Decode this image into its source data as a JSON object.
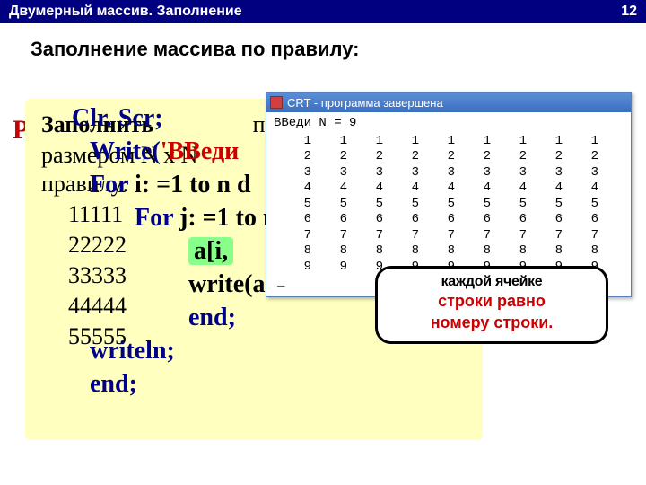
{
  "header": {
    "title": "Двумерный массив. Заполнение",
    "page": "12"
  },
  "subtitle": "Заполнение массива по правилу:",
  "red_letter": "Р",
  "task": {
    "line1a": "Заполнить",
    "line1b": "пр",
    "line2": "размером   N  x   N",
    "line3": "правилу:",
    "n1": "11111",
    "n2": "22222",
    "n3": "33333",
    "n4": "44444",
    "n5": "55555"
  },
  "code": {
    "l1": "Clr. Scr;",
    "l2a": "Write(",
    "l2b": "'ВВеди",
    "l3a": "For",
    "l3b": " i: =1 to n d",
    "l4a": "For",
    "l4b": " j: =1 to n",
    "l5": "a[i,",
    "l6": "write(a[i, j]: 4);",
    "l7": "end;",
    "l8": "writeln;",
    "l9": "end;"
  },
  "crt": {
    "title": "CRT - программа завершена",
    "prompt": "ВВеди N = 9",
    "rows": [
      [
        1,
        1,
        1,
        1,
        1,
        1,
        1,
        1,
        1
      ],
      [
        2,
        2,
        2,
        2,
        2,
        2,
        2,
        2,
        2
      ],
      [
        3,
        3,
        3,
        3,
        3,
        3,
        3,
        3,
        3
      ],
      [
        4,
        4,
        4,
        4,
        4,
        4,
        4,
        4,
        4
      ],
      [
        5,
        5,
        5,
        5,
        5,
        5,
        5,
        5,
        5
      ],
      [
        6,
        6,
        6,
        6,
        6,
        6,
        6,
        6,
        6
      ],
      [
        7,
        7,
        7,
        7,
        7,
        7,
        7,
        7,
        7
      ],
      [
        8,
        8,
        8,
        8,
        8,
        8,
        8,
        8,
        8
      ],
      [
        9,
        9,
        9,
        9,
        9,
        9,
        9,
        9,
        9
      ]
    ],
    "cursor": "_"
  },
  "bubble": {
    "top": "каждой ячейке",
    "l1": "строки равно",
    "l2": "номеру строки."
  }
}
